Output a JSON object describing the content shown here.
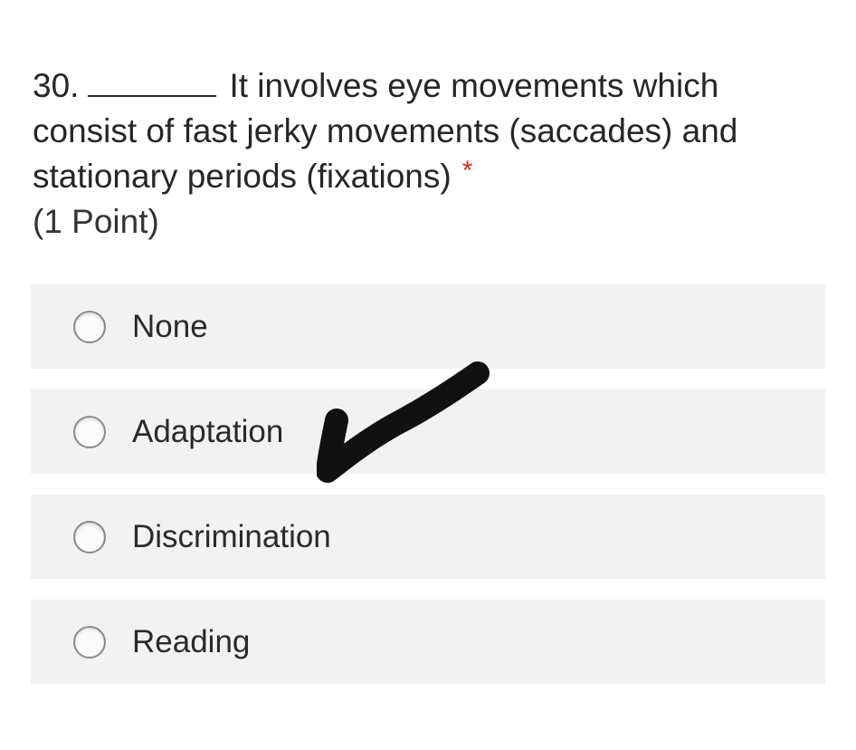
{
  "question": {
    "number": "30.",
    "line1_text": "It involves eye movements which",
    "line2_text": "consist of fast jerky movements (saccades) and",
    "line3_text": "stationary periods (fixations)",
    "required_marker": "*",
    "points": "(1 Point)"
  },
  "options": [
    {
      "label": "None",
      "selected": false
    },
    {
      "label": "Adaptation",
      "selected": false
    },
    {
      "label": "Discrimination",
      "selected": false
    },
    {
      "label": "Reading",
      "selected": false
    }
  ],
  "annotation": {
    "type": "handwritten-checkmark",
    "color": "#111111",
    "next_to_option": "Adaptation"
  },
  "colors": {
    "required": "#d93025",
    "option_background": "#f2f2f2",
    "text": "#262626"
  }
}
